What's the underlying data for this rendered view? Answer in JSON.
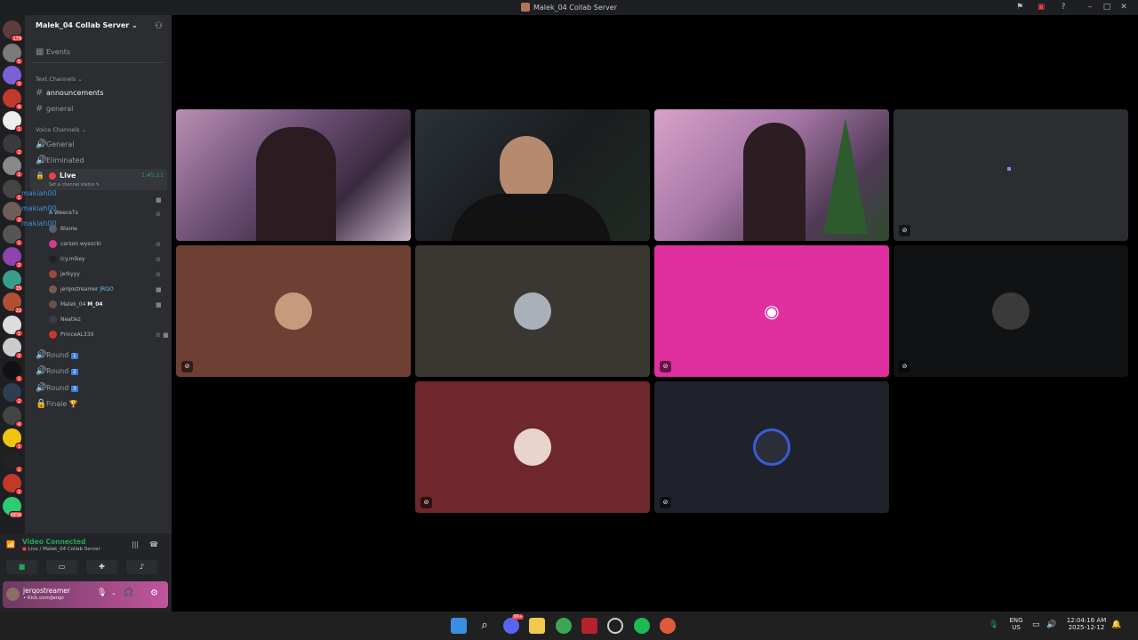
{
  "window": {
    "title": "Malek_04 Collab Server"
  },
  "server": {
    "name": "Malek_04 Collab Server",
    "events_label": "Events",
    "text_category": "Text Channels",
    "voice_category": "Voice Channels",
    "text_channels": [
      "announcements",
      "general"
    ],
    "voice_channels_top": [
      "General",
      "Eliminated"
    ],
    "live_channel": {
      "name": "Live",
      "timer": "1:45:11",
      "status_placeholder": "Set a channel status"
    },
    "voice_users": [
      {
        "name": "A WeeceTx",
        "color": "#8a6d5a"
      },
      {
        "name": "Blame",
        "color": "#5b5f66"
      },
      {
        "name": "carson wysocki",
        "color": "#d23c8f"
      },
      {
        "name": "icy.mikey",
        "color": "#222"
      },
      {
        "name": "jerkyyy",
        "color": "#9c4a3a"
      },
      {
        "name": "jerqostreamer",
        "color": "#7a5c4f",
        "tag": "JRQO"
      },
      {
        "name": "Malek_04",
        "color": "#6b5148",
        "tag": "M_04"
      },
      {
        "name": "Neatlez",
        "color": "#3b3e45"
      },
      {
        "name": "PrinceAL33X",
        "color": "#c8392f"
      }
    ],
    "overlay_names": [
      "makiah00",
      "makiah00",
      "makiah00"
    ],
    "voice_channels_bottom": [
      {
        "name": "Round",
        "badge": "1"
      },
      {
        "name": "Round",
        "badge": "2"
      },
      {
        "name": "Round",
        "badge": "3"
      },
      {
        "name": "Finale",
        "badge": "🏆"
      }
    ]
  },
  "guild_badges": [
    "179",
    "5",
    "3",
    "4",
    "1",
    "2",
    "1",
    "1",
    "2",
    "1",
    "2",
    "15",
    "22",
    "1",
    "1",
    "1",
    "2",
    "4",
    "1",
    "1",
    "1",
    "NEW"
  ],
  "voice_panel": {
    "status": "Video Connected",
    "location": "Live / Malek_04 Collab Server"
  },
  "user_panel": {
    "username": "jerqostreamer",
    "subtext": "Kick.com/Jerqo"
  },
  "taskbar": {
    "lang": "ENG",
    "region": "US",
    "time": "12:04:16 AM",
    "date": "2025-12-12",
    "discord_badge": "99+"
  },
  "colors": {
    "accent_green": "#23a55a",
    "discord_pink": "#e02f9e"
  }
}
